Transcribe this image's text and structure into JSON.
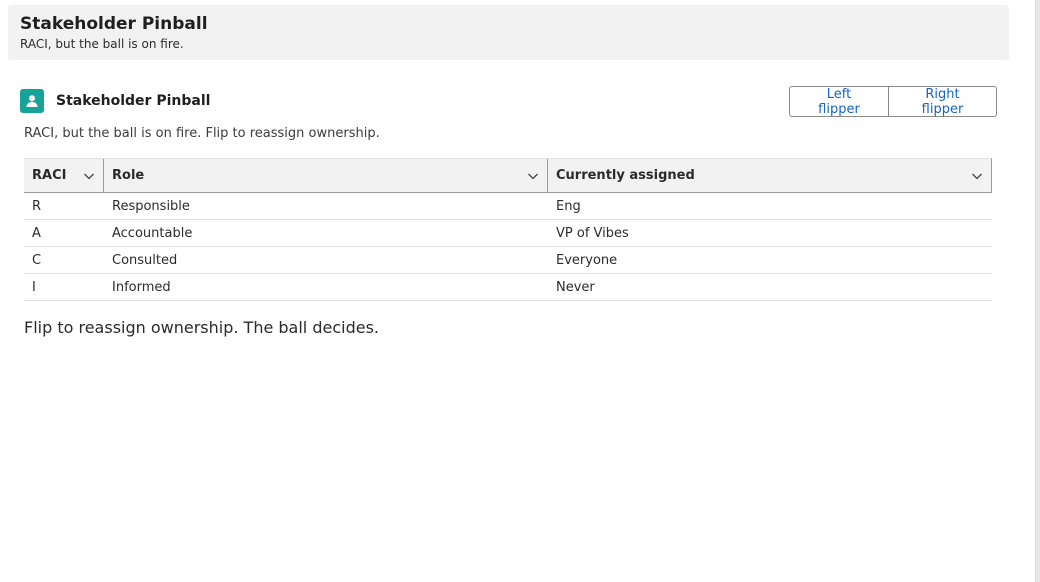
{
  "header": {
    "title": "Stakeholder Pinball",
    "subtitle": "RACI, but the ball is on fire."
  },
  "card": {
    "icon": "user-icon",
    "title": "Stakeholder Pinball",
    "description": "RACI, but the ball is on fire. Flip to reassign ownership.",
    "buttons": {
      "left": "Left flipper",
      "right": "Right flipper"
    }
  },
  "table": {
    "columns": [
      "RACI",
      "Role",
      "Currently assigned"
    ],
    "rows": [
      [
        "R",
        "Responsible",
        "Eng"
      ],
      [
        "A",
        "Accountable",
        "VP of Vibes"
      ],
      [
        "C",
        "Consulted",
        "Everyone"
      ],
      [
        "I",
        "Informed",
        "Never"
      ]
    ]
  },
  "footer": "Flip to reassign ownership. The ball decides.",
  "colors": {
    "accent": "#17a398",
    "link": "#1565c0",
    "header_bg": "#f2f2f2"
  }
}
